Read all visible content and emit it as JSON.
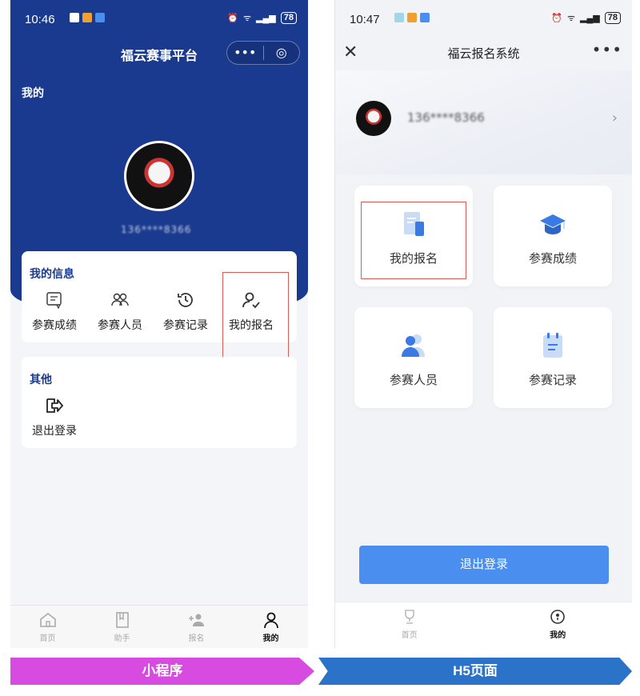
{
  "left": {
    "status": {
      "time": "10:46",
      "battery": "78"
    },
    "title": "福云赛事平台",
    "capsule": {
      "more": "•••",
      "close": "◎"
    },
    "mine_label": "我的",
    "username": "136****8366",
    "info_card": {
      "title": "我的信息",
      "items": [
        {
          "label": "参赛成绩",
          "icon": "certificate-icon"
        },
        {
          "label": "参赛人员",
          "icon": "people-icon"
        },
        {
          "label": "参赛记录",
          "icon": "history-icon"
        },
        {
          "label": "我的报名",
          "icon": "user-check-icon"
        }
      ]
    },
    "other_card": {
      "title": "其他",
      "logout": "退出登录"
    },
    "tabs": [
      {
        "label": "首页",
        "icon": "home-icon"
      },
      {
        "label": "助手",
        "icon": "book-icon"
      },
      {
        "label": "报名",
        "icon": "add-user-icon"
      },
      {
        "label": "我的",
        "icon": "person-icon"
      }
    ]
  },
  "right": {
    "status": {
      "time": "10:47",
      "battery": "78"
    },
    "title": "福云报名系统",
    "close": "✕",
    "more": "•••",
    "username": "136****8366",
    "tiles": [
      {
        "label": "我的报名",
        "icon": "document-icon"
      },
      {
        "label": "参赛成绩",
        "icon": "graduation-cap-icon"
      },
      {
        "label": "参赛人员",
        "icon": "people-icon"
      },
      {
        "label": "参赛记录",
        "icon": "clipboard-icon"
      }
    ],
    "logout": "退出登录",
    "tabs": [
      {
        "label": "首页",
        "icon": "trophy-icon"
      },
      {
        "label": "我的",
        "icon": "person-icon"
      }
    ]
  },
  "banners": {
    "miniprogram": "小程序",
    "h5": "H5页面"
  },
  "colors": {
    "primary_blue": "#1a3a8f",
    "button_blue": "#4a8ef0",
    "highlight_red": "#e05a52",
    "banner_pink": "#d74be0",
    "banner_blue": "#2a73c9"
  }
}
